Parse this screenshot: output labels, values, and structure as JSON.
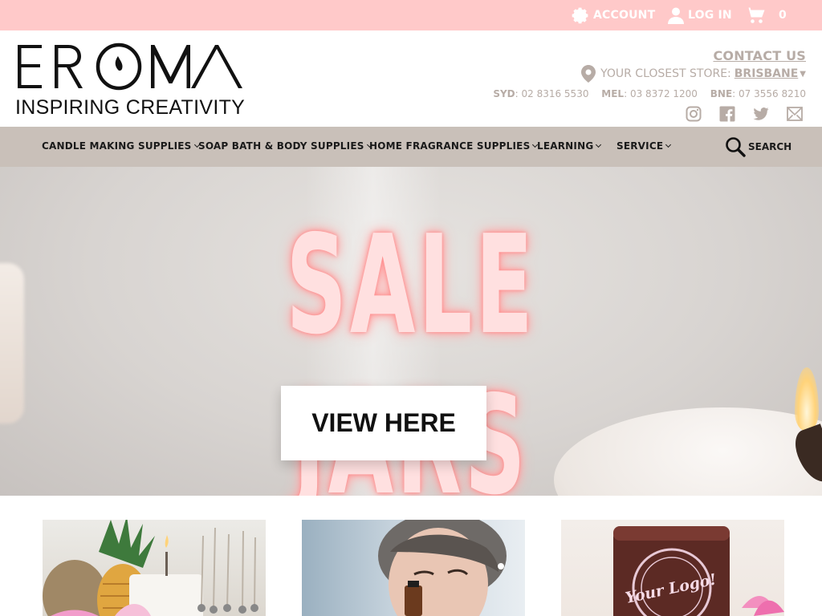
{
  "topbar": {
    "account_label": "ACCOUNT",
    "login_label": "LOG IN",
    "cart_count": "0",
    "icons": [
      "gear-icon",
      "user-icon",
      "cart-icon"
    ]
  },
  "brand": {
    "logo_text": "EROMA",
    "tagline": "INSPIRING CREATIVITY"
  },
  "header": {
    "contact_label": "CONTACT US",
    "store_prefix": "YOUR CLOSEST STORE:",
    "store_name": "BRISBANE",
    "phones": [
      {
        "city": "SYD",
        "number": ": 02 8316 5530"
      },
      {
        "city": "MEL",
        "number": ": 03 8372 1200"
      },
      {
        "city": "BNE",
        "number": ": 07 3556 8210"
      }
    ],
    "social_icons": [
      "instagram-icon",
      "facebook-icon",
      "twitter-icon",
      "mail-icon"
    ]
  },
  "nav": {
    "items": [
      {
        "label": "CANDLE MAKING SUPPLIES"
      },
      {
        "label": "SOAP BATH & BODY SUPPLIES"
      },
      {
        "label": "HOME FRAGRANCE SUPPLIES"
      },
      {
        "label": "LEARNING"
      },
      {
        "label": "SERVICE"
      }
    ],
    "search_label": "SEARCH"
  },
  "hero": {
    "title": "SALE JARS",
    "button_label": "VIEW HERE"
  },
  "colors": {
    "topbar": "#ffc9c9",
    "nav": "#c9c0b9",
    "muted_text": "#b7aca6"
  },
  "tiles": {
    "logo_text": "Your Logo!"
  }
}
